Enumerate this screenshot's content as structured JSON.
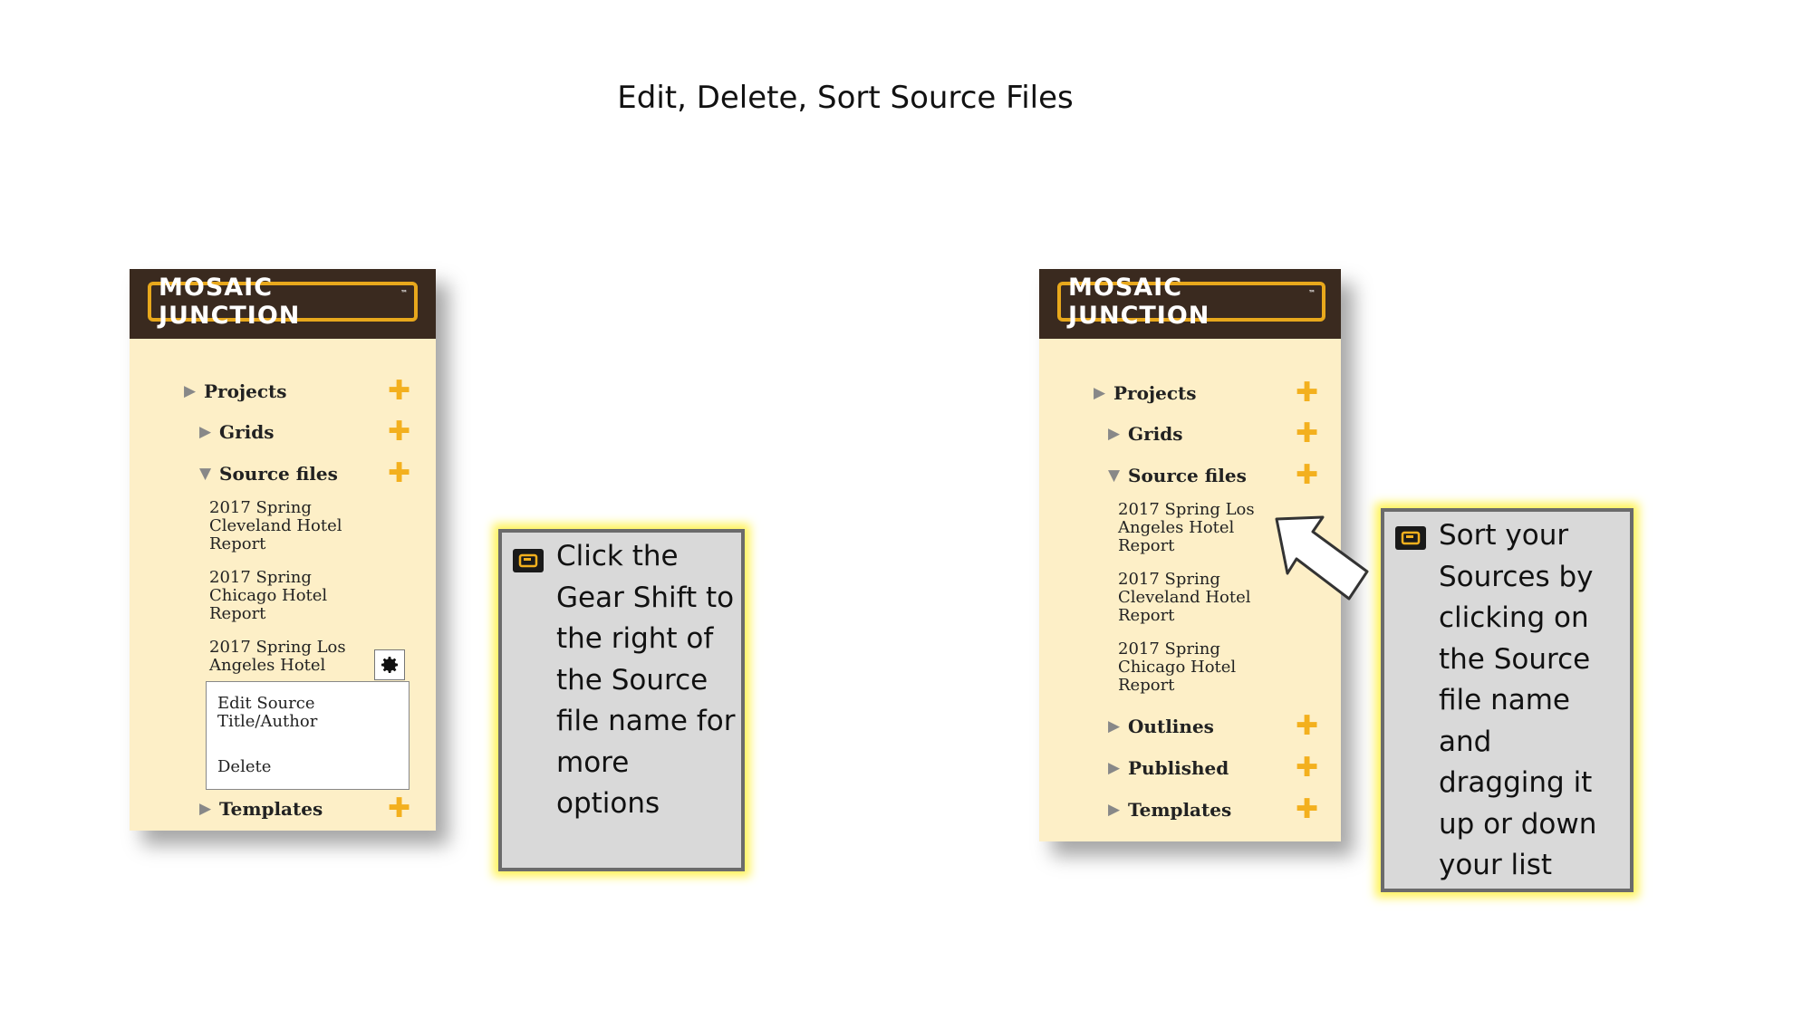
{
  "slide": {
    "title": "Edit, Delete, Sort Source Files"
  },
  "logo": {
    "text": "MOSAIC JUNCTION",
    "tm": "™"
  },
  "colors": {
    "logo_bar": "#3a2a1f",
    "panel_bg": "#fdefc7",
    "accent": "#f3b01e",
    "callout_bg": "#d9d9d9",
    "glow": "#fff35a"
  },
  "left_panel": {
    "nav": [
      "Projects",
      "Grids",
      "Source files",
      "Templates"
    ],
    "source_files": [
      "2017 Spring Cleveland Hotel Report",
      "2017 Spring Chicago Hotel Report",
      "2017 Spring Los Angeles Hotel"
    ],
    "gear_icon": "gear-icon",
    "menu": [
      "Edit Source Title/Author",
      "Delete"
    ]
  },
  "right_panel": {
    "nav": [
      "Projects",
      "Grids",
      "Source files",
      "Outlines",
      "Published",
      "Templates"
    ],
    "source_files": [
      "2017 Spring Los Angeles Hotel Report",
      "2017 Spring Cleveland Hotel Report",
      "2017 Spring Chicago Hotel Report"
    ]
  },
  "callouts": {
    "left": "Click the Gear Shift to the right of the Source file name for more options",
    "right": "Sort your Sources by clicking on the Source file name and dragging it up or down your list"
  }
}
